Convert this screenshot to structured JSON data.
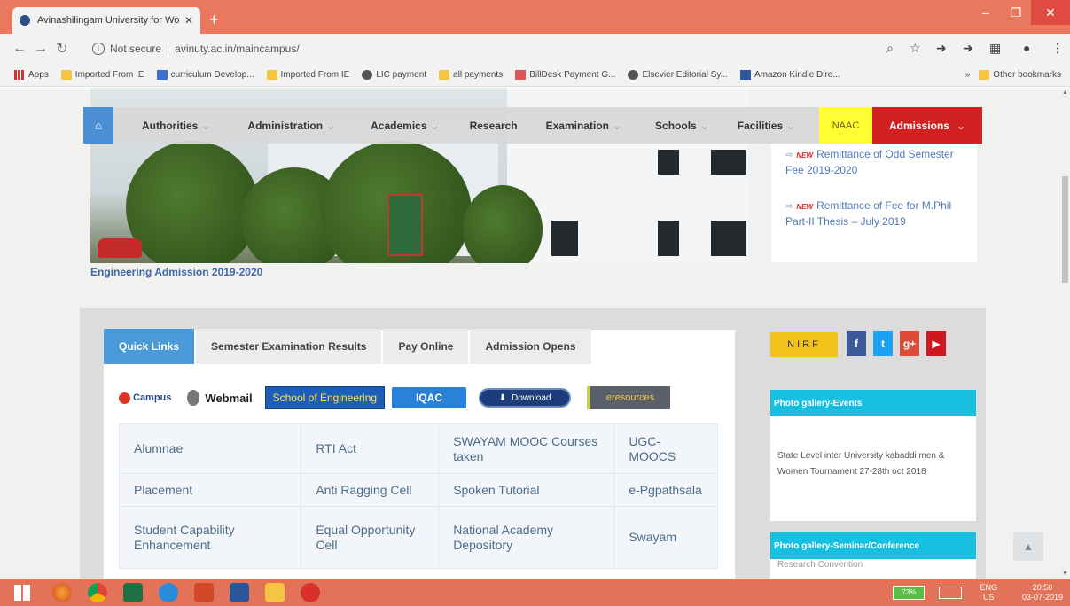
{
  "browser": {
    "tab_title": "Avinashilingam University for Wo",
    "tab_close": "✕",
    "new_tab": "+",
    "url_security": "Not secure",
    "url": "avinuty.ac.in/maincampus/",
    "bookmarks": [
      {
        "label": "Apps",
        "icon": "apps-icon"
      },
      {
        "label": "Imported From IE",
        "icon": "folder-icon"
      },
      {
        "label": "curriculum Develop...",
        "icon": "doc-icon"
      },
      {
        "label": "Imported From IE",
        "icon": "folder-icon"
      },
      {
        "label": "LIC payment",
        "icon": "globe-icon"
      },
      {
        "label": "all payments",
        "icon": "folder-icon"
      },
      {
        "label": "BillDesk Payment G...",
        "icon": "billdesk-icon"
      },
      {
        "label": "Elsevier Editorial Sy...",
        "icon": "globe-icon"
      },
      {
        "label": "Amazon Kindle Dire...",
        "icon": "amazon-icon"
      }
    ],
    "overflow": "»",
    "other_bookmarks": "Other bookmarks"
  },
  "nav": {
    "items": [
      "Authorities",
      "Administration",
      "Academics",
      "Research",
      "Examination",
      "Schools",
      "Facilities"
    ],
    "naac": "NAAC",
    "admissions": "Admissions"
  },
  "notices": [
    {
      "new": "NEW",
      "text": "Remittance of Odd Semester Fee 2019-2020"
    },
    {
      "new": "NEW",
      "text": "Remittance of Fee for M.Phil Part-II Thesis – July 2019"
    }
  ],
  "hero_caption": "Engineering Admission 2019-2020",
  "tabs": [
    "Quick Links",
    "Semester Examination Results",
    "Pay Online",
    "Admission Opens"
  ],
  "logos": {
    "campus": "Campus",
    "webmail": "Webmail",
    "soe": "School of Engineering",
    "iqac": "IQAC",
    "download": "Download",
    "eresources": "eresources"
  },
  "links": [
    [
      "Alumnae",
      "RTI Act",
      "SWAYAM MOOC Courses taken",
      "UGC-MOOCS"
    ],
    [
      "Placement",
      "Anti Ragging Cell",
      "Spoken Tutorial",
      "e-Pgpathsala"
    ],
    [
      "Student Capability Enhancement",
      "Equal Opportunity Cell",
      "National Academy Depository",
      "Swayam"
    ]
  ],
  "sidebar": {
    "nirf": "NIRF",
    "social": [
      "f",
      "t",
      "g+",
      "▶"
    ],
    "gallery_events_title": "Photo gallery-Events",
    "gallery_events_text": "State Level inter University kabaddi men & Women Tournament 27-28th oct 2018",
    "gallery_seminar_title": "Photo gallery-Seminar/Conference",
    "gallery_seminar_text": "Research Convention"
  },
  "taskbar": {
    "battery": "73%",
    "lang1": "ENG",
    "lang2": "US",
    "time": "20:50",
    "date": "03-07-2019"
  },
  "colors": {
    "titlebar": "#e8795e",
    "nav_home": "#4d8fd5",
    "naac": "#ffff33",
    "admissions": "#d21f1f",
    "tab_active": "#4a9ad8",
    "gallery_header": "#17c0e0"
  }
}
